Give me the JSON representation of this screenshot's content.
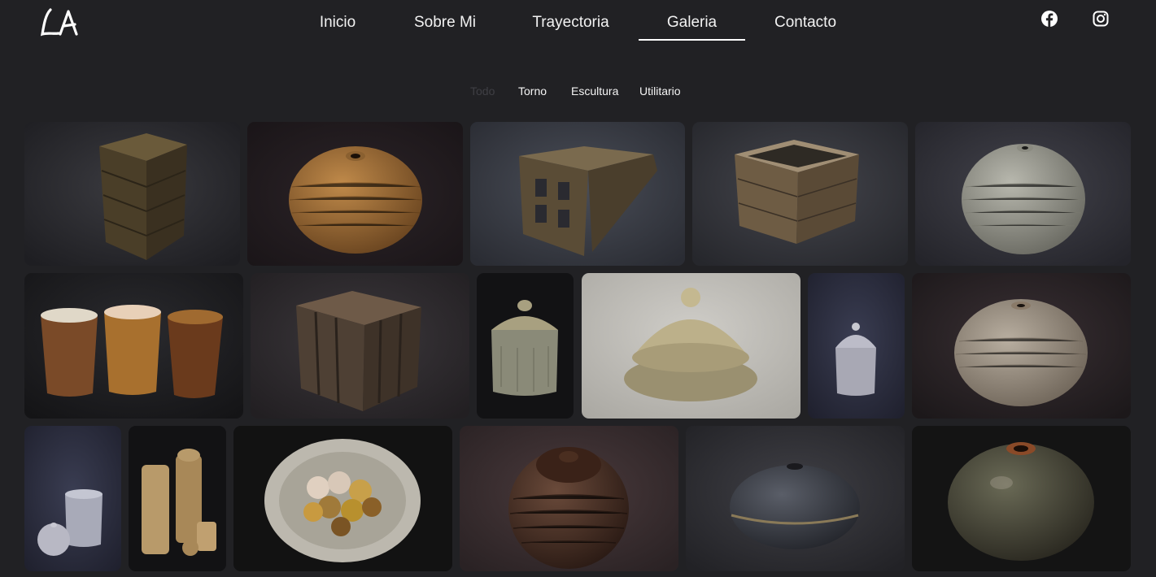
{
  "logo": {
    "text": "LA"
  },
  "nav": {
    "items": [
      {
        "label": "Inicio",
        "active": false
      },
      {
        "label": "Sobre Mi",
        "active": false
      },
      {
        "label": "Trayectoria",
        "active": false
      },
      {
        "label": "Galeria",
        "active": true
      },
      {
        "label": "Contacto",
        "active": false
      }
    ]
  },
  "social": [
    "facebook-icon",
    "instagram-icon"
  ],
  "filters": {
    "items": [
      {
        "label": "Todo",
        "active": true
      },
      {
        "label": "Torno",
        "active": false
      },
      {
        "label": "Escultura",
        "active": false
      },
      {
        "label": "Utilitario",
        "active": false
      }
    ]
  },
  "colors": {
    "background": "#212124",
    "text": "#f2f2f2",
    "inactive_filter": "#3f3f44"
  },
  "gallery": {
    "items": [
      "ceramic-crate-tall",
      "ceramic-round-vase-brown",
      "ceramic-open-crate",
      "ceramic-crate-wide",
      "ceramic-round-vase-grey",
      "ceramic-three-cups",
      "ceramic-crate-slatted",
      "ceramic-lidded-jar",
      "ceramic-covered-dish",
      "ceramic-small-lidded-jar",
      "ceramic-round-vase-light",
      "ceramic-cylinder-jar",
      "ceramic-jar-set",
      "ceramic-bowl-with-flowers",
      "ceramic-textured-sphere",
      "ceramic-flat-vase-dark",
      "ceramic-round-vase-glossy"
    ]
  }
}
